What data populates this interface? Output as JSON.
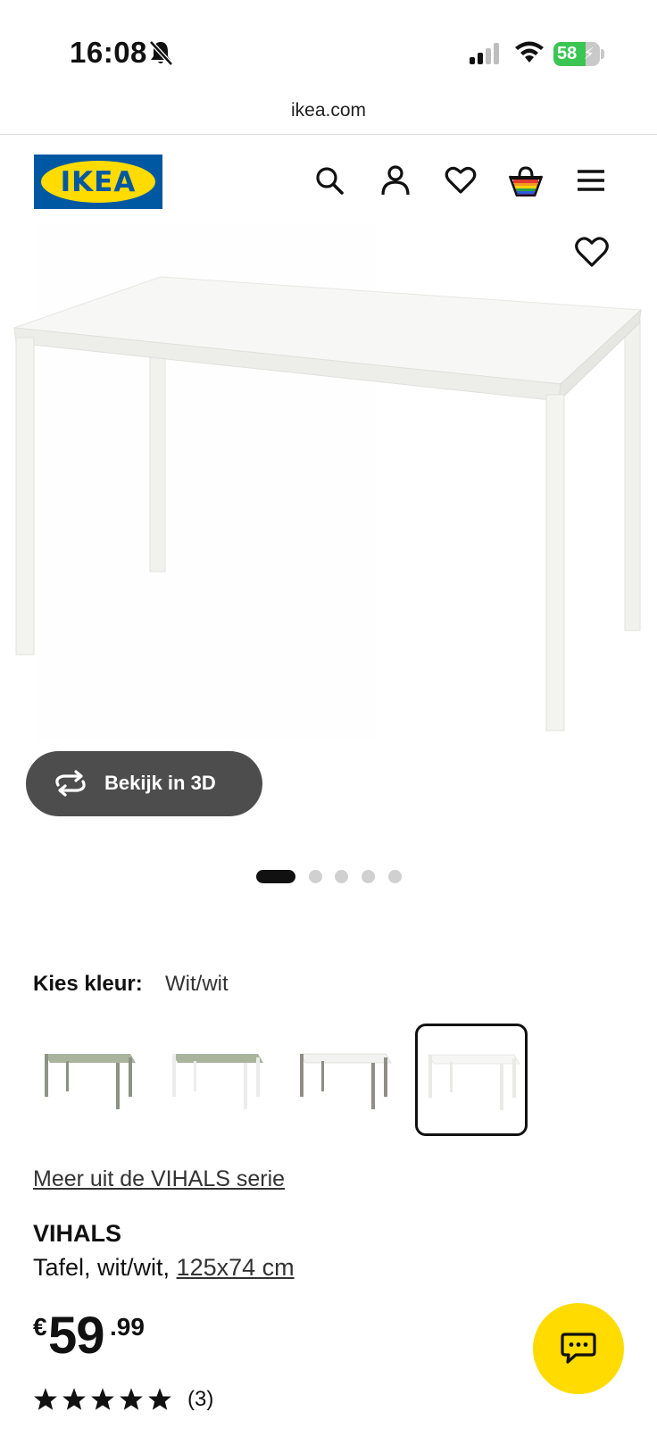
{
  "status_bar": {
    "time": "16:08",
    "battery": "58",
    "icons": [
      "bell-slash-icon",
      "signal-icon",
      "wifi-icon",
      "battery-icon"
    ]
  },
  "browser": {
    "url": "ikea.com"
  },
  "header": {
    "logo_text": "IKEA",
    "icons": [
      "search-icon",
      "account-icon",
      "wishlist-icon",
      "cart-icon",
      "menu-icon"
    ]
  },
  "product_image": {
    "view_3d_label": "Bekijk in 3D",
    "carousel_count": 5,
    "carousel_active": 1
  },
  "color": {
    "label": "Kies kleur:",
    "value": "Wit/wit",
    "options": [
      {
        "top": "#a9b49d",
        "legs": "#8e9283"
      },
      {
        "top": "#a9b49d",
        "legs": "#ececec"
      },
      {
        "top": "#f2f2f0",
        "legs": "#8e8e86"
      },
      {
        "top": "#f6f6f4",
        "legs": "#e9e9e7",
        "selected": true
      }
    ]
  },
  "series_link": "Meer uit de VIHALS serie",
  "product": {
    "name": "VIHALS",
    "description": "Tafel, wit/wit, ",
    "size": "125x74 cm",
    "price_currency": "€",
    "price_integer": "59",
    "price_decimal": ".99",
    "rating_stars": 5,
    "review_count": "(3)"
  },
  "colors": {
    "ikea_blue": "#0058a3",
    "ikea_yellow": "#ffdb00",
    "dark_button": "#4d4d4d"
  }
}
